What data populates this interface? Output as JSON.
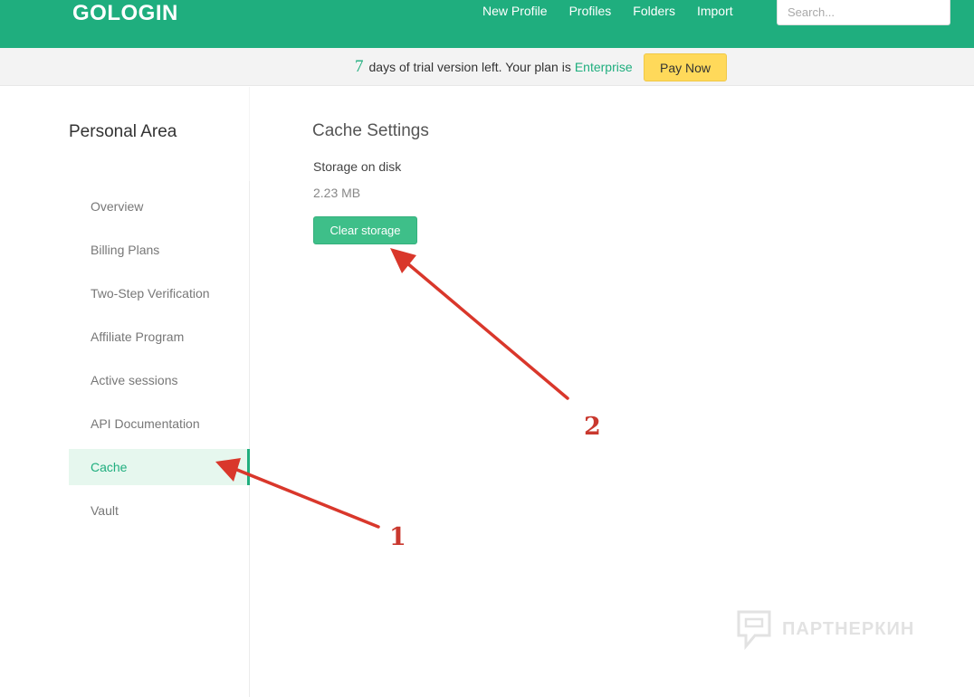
{
  "header": {
    "logo_text": "GOLOGIN",
    "nav": [
      "New Profile",
      "Profiles",
      "Folders",
      "Import"
    ],
    "search_placeholder": "Search...",
    "colors": {
      "brand": "#1fae7e",
      "banner_bg": "#f3f3f3",
      "pay_button": "#ffd95a"
    }
  },
  "banner": {
    "days": "7",
    "text": "days of trial version left. Your plan is",
    "plan": "Enterprise",
    "pay_button": "Pay Now"
  },
  "sidebar": {
    "title": "Personal Area",
    "items": [
      {
        "label": "Overview",
        "active": false
      },
      {
        "label": "Billing Plans",
        "active": false
      },
      {
        "label": "Two-Step Verification",
        "active": false
      },
      {
        "label": "Affiliate Program",
        "active": false
      },
      {
        "label": "Active sessions",
        "active": false
      },
      {
        "label": "API Documentation",
        "active": false
      },
      {
        "label": "Cache",
        "active": true
      },
      {
        "label": "Vault",
        "active": false
      }
    ]
  },
  "main": {
    "title": "Cache Settings",
    "storage_label": "Storage on disk",
    "storage_value": "2.23 MB",
    "clear_button": "Clear storage"
  },
  "annotations": {
    "numbers": [
      "1",
      "2"
    ],
    "color": "#d9372b"
  },
  "watermark": {
    "text": "ПАРТНЕРКИН",
    "icon": "chat-bubble-icon"
  }
}
